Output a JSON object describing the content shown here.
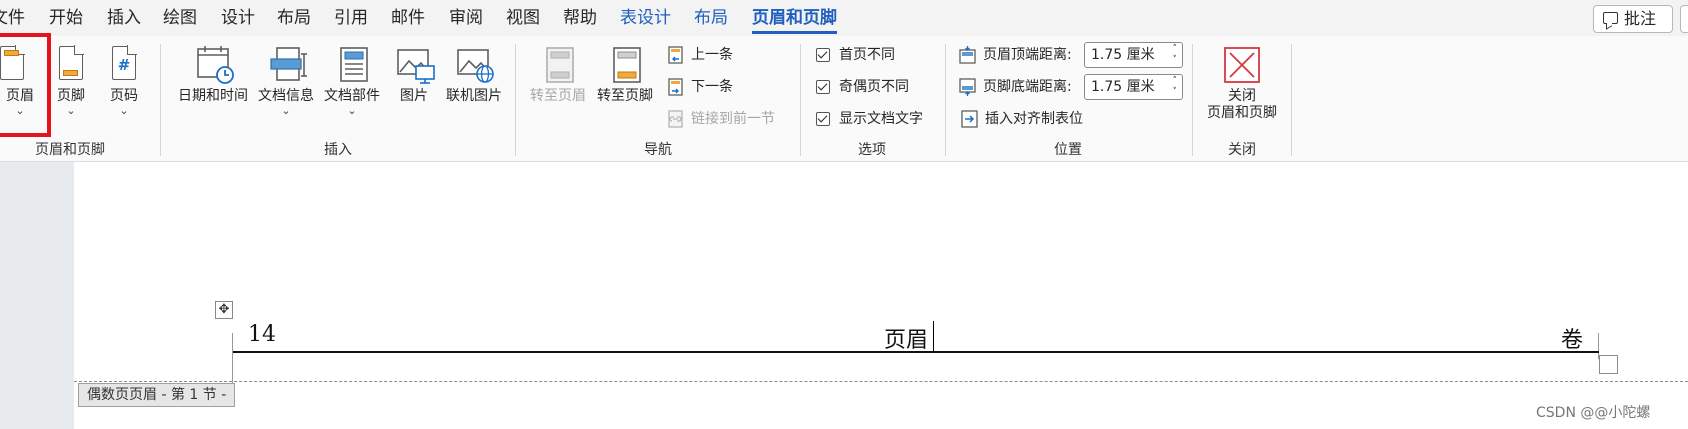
{
  "tabs": [
    "文件",
    "开始",
    "插入",
    "绘图",
    "设计",
    "布局",
    "引用",
    "邮件",
    "审阅",
    "视图",
    "帮助",
    "表设计",
    "布局",
    "页眉和页脚"
  ],
  "comment_label": "批注",
  "groups": {
    "header_footer": {
      "label": "页眉和页脚",
      "header": "页眉",
      "footer": "页脚",
      "page_number": "页码"
    },
    "insert": {
      "label": "插入",
      "date_time": "日期和时间",
      "doc_info": "文档信息",
      "doc_parts": "文档部件",
      "picture": "图片",
      "online_picture": "联机图片"
    },
    "navigation": {
      "label": "导航",
      "goto_header": "转至页眉",
      "goto_footer": "转至页脚",
      "previous": "上一条",
      "next": "下一条",
      "link_previous": "链接到前一节"
    },
    "options": {
      "label": "选项",
      "different_first": "首页不同",
      "different_odd_even": "奇偶页不同",
      "show_doc_text": "显示文档文字"
    },
    "position": {
      "label": "位置",
      "header_top_label": "页眉顶端距离:",
      "header_top_value": "1.75 厘米",
      "footer_bottom_label": "页脚底端距离:",
      "footer_bottom_value": "1.75 厘米",
      "insert_align_tab": "插入对齐制表位"
    },
    "close": {
      "label": "关闭",
      "close_line1": "关闭",
      "close_line2": "页眉和页脚"
    }
  },
  "document": {
    "header_left": "14",
    "header_center": "页眉",
    "header_right": "卷",
    "section_tag": "偶数页页眉 - 第 1 节 -"
  },
  "watermark": "CSDN @@小陀螺",
  "colors": {
    "accent": "#1f5fbf",
    "highlight": "#e5141e",
    "icon_orange": "#f2a93b",
    "close_red": "#d9373e"
  }
}
